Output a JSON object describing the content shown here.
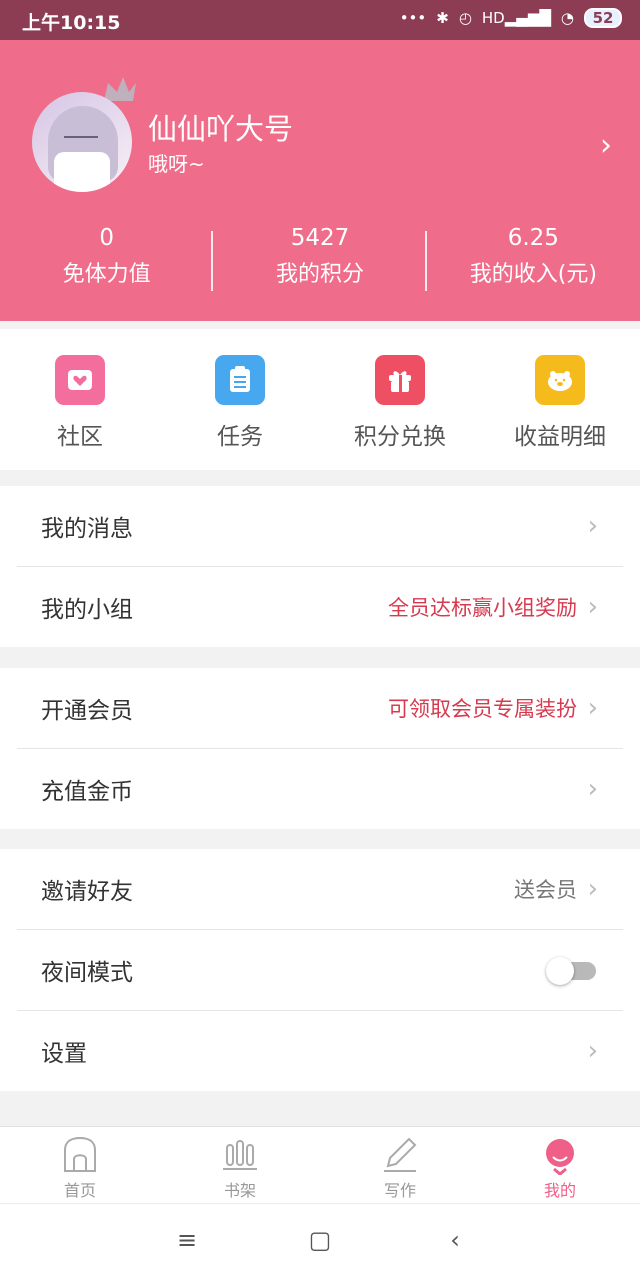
{
  "status_bar": {
    "time": "上午10:15",
    "signal_label": "HD",
    "battery": "52"
  },
  "profile": {
    "name": "仙仙吖大号",
    "bio": "哦呀~",
    "stats": [
      {
        "value": "0",
        "label": "免体力值"
      },
      {
        "value": "5427",
        "label": "我的积分"
      },
      {
        "value": "6.25",
        "label": "我的收入(元)"
      }
    ],
    "colors": {
      "header_bg": "#ef6d8b",
      "status_bg": "#8c3d54"
    }
  },
  "quick_actions": [
    {
      "label": "社区",
      "icon": "heart-envelope-icon",
      "color": "#f46e9d"
    },
    {
      "label": "任务",
      "icon": "task-list-icon",
      "color": "#47a7ef"
    },
    {
      "label": "积分兑换",
      "icon": "gift-icon",
      "color": "#ef4f63"
    },
    {
      "label": "收益明细",
      "icon": "piggy-bank-icon",
      "color": "#f5bb1c"
    }
  ],
  "menu_groups": [
    {
      "items": [
        {
          "title": "我的消息",
          "note": ""
        },
        {
          "title": "我的小组",
          "note": "全员达标赢小组奖励"
        }
      ]
    },
    {
      "items": [
        {
          "title": "开通会员",
          "note": "可领取会员专属装扮"
        },
        {
          "title": "充值金币",
          "note": ""
        }
      ]
    },
    {
      "items": [
        {
          "title": "邀请好友",
          "note": "送会员"
        },
        {
          "title": "夜间模式",
          "toggle": false
        },
        {
          "title": "设置",
          "note": ""
        }
      ]
    }
  ],
  "tabbar": {
    "tabs": [
      {
        "label": "首页",
        "icon": "home-icon",
        "active": false
      },
      {
        "label": "书架",
        "icon": "bookshelf-icon",
        "active": false
      },
      {
        "label": "写作",
        "icon": "pencil-icon",
        "active": false
      },
      {
        "label": "我的",
        "icon": "profile-icon",
        "active": true
      }
    ]
  }
}
